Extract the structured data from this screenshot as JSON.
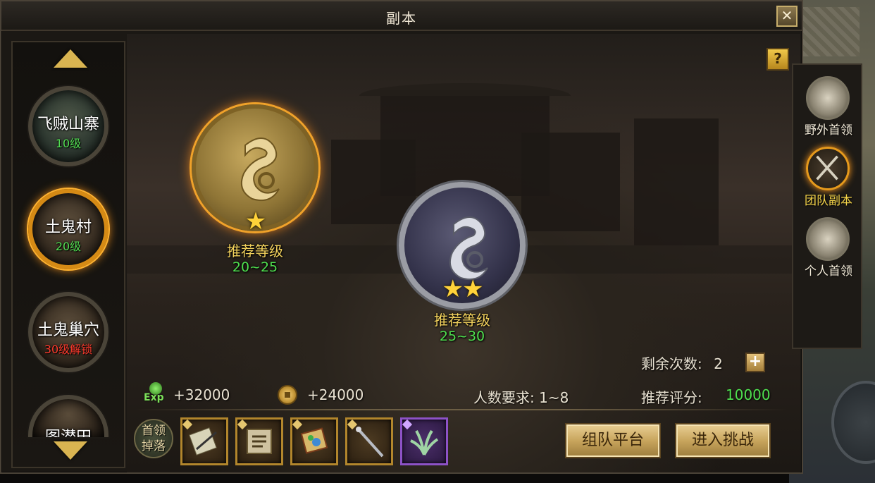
{
  "window": {
    "title": "副本"
  },
  "dungeons": [
    {
      "name": "飞贼山寨",
      "level": "10级"
    },
    {
      "name": "土鬼村",
      "level": "20级"
    },
    {
      "name": "土鬼巢穴",
      "level": "30级解锁"
    },
    {
      "name": "图潜田",
      "level": ""
    }
  ],
  "difficulties": [
    {
      "stars": 1,
      "star_text": "★",
      "label": "推荐等级",
      "range": "20~25"
    },
    {
      "stars": 2,
      "star_text": "★★",
      "label": "推荐等级",
      "range": "25~30"
    }
  ],
  "info": {
    "remaining_label": "剩余次数:",
    "remaining_value": "2",
    "exp_icon_text": "Exp",
    "exp_reward": "+32000",
    "gold_reward": "+24000",
    "player_req": "人数要求:  1~8",
    "score_label": "推荐评分:",
    "score_value": "10000"
  },
  "drops": {
    "label_line1": "首领",
    "label_line2": "掉落",
    "items": [
      {
        "icon": "scroll-blade-icon",
        "rarity": "gold"
      },
      {
        "icon": "rune-book-icon",
        "rarity": "gold"
      },
      {
        "icon": "treasure-map-icon",
        "rarity": "gold"
      },
      {
        "icon": "staff-icon",
        "rarity": "gold"
      },
      {
        "icon": "herb-icon",
        "rarity": "purple"
      }
    ]
  },
  "buttons": {
    "team_platform": "组队平台",
    "enter_challenge": "进入挑战",
    "close": "✕",
    "help": "?",
    "plus": "+"
  },
  "tabs": [
    {
      "label": "野外首领"
    },
    {
      "label": "团队副本"
    },
    {
      "label": "个人首领"
    }
  ],
  "colors": {
    "accent_orange": "#ff9a1e",
    "level_green": "#52dc52",
    "locked_red": "#ff3b2d",
    "rec_yellow": "#f4d35d",
    "gold_button": "#c8a55d"
  }
}
